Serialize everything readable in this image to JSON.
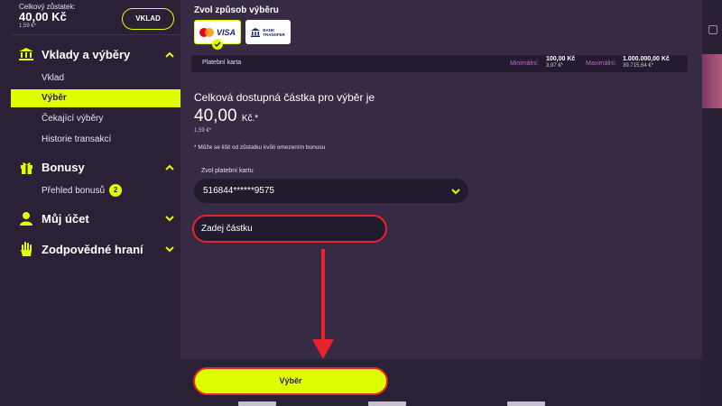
{
  "account": {
    "balance_label": "Celkový zůstatek:",
    "balance_value": "40,00 Kč",
    "balance_eur": "1,59 €*",
    "deposit_button": "VKLAD"
  },
  "sidebar": {
    "sections": [
      {
        "title": "Vklady a výběry",
        "icon": "bank-icon",
        "expanded": true
      },
      {
        "title": "Bonusy",
        "icon": "gift-icon",
        "expanded": true
      },
      {
        "title": "Můj účet",
        "icon": "user-icon",
        "expanded": false
      },
      {
        "title": "Zodpovědné hraní",
        "icon": "hand-icon",
        "expanded": false
      }
    ],
    "items": [
      "Vklad",
      "Výběr",
      "Čekající výběry",
      "Historie transakcí"
    ],
    "bonus_items": [
      {
        "label": "Přehled bonusů",
        "badge": "2"
      }
    ],
    "active_item": "Výběr"
  },
  "withdrawal": {
    "method_title": "Zvol způsob výběru",
    "methods": [
      {
        "name": "Platební karta",
        "logos": [
          "mastercard",
          "VISA"
        ],
        "selected": true
      },
      {
        "name": "BANK TRANSFER",
        "lines": [
          "BANK",
          "TRANSFER"
        ],
        "selected": false
      }
    ],
    "selected_method_label": "Platební karta",
    "min_label": "Minimální:",
    "min_value": "100,00 Kč",
    "min_eur": "3,97 €*",
    "max_label": "Maximální:",
    "max_value": "1.000.000,00 Kč",
    "max_eur": "39.715,64 €*",
    "available_label": "Celková dostupná částka pro výběr je",
    "available_amount": "40,00",
    "available_currency": "Kč.*",
    "available_eur": "1,59 €*",
    "note": "* Může se lišit od zůstatku kvůli omezením bonusu",
    "card_label": "Zvol platební kartu",
    "card_value": "516844******9575",
    "amount_placeholder": "Zadej částku",
    "submit_button": "Výběr"
  },
  "colors": {
    "accent": "#ddff00",
    "highlight": "#e8232b",
    "panel": "#362a44",
    "sidebar": "#2b2137"
  }
}
